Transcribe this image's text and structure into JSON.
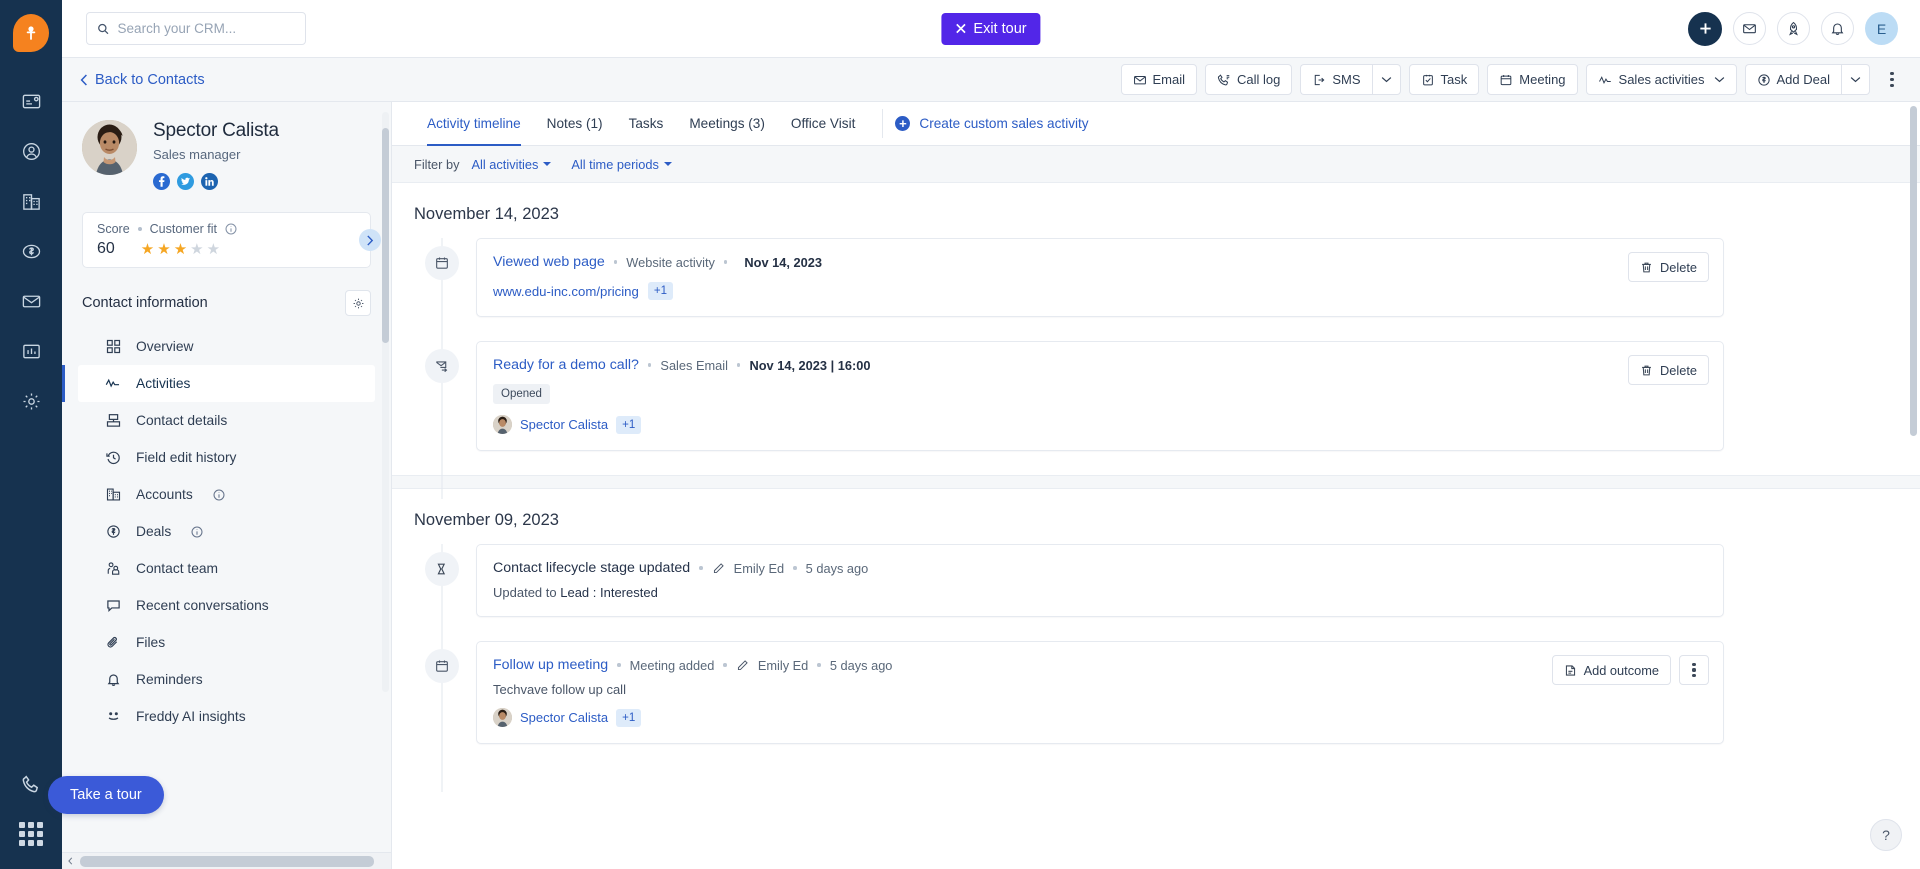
{
  "app": {
    "logo_icon": "freshworks-logo-icon",
    "rail_items": [
      {
        "name": "sidebar-rail-activities",
        "icon": "card-activity-icon"
      },
      {
        "name": "sidebar-rail-contacts",
        "icon": "contact-person-icon"
      },
      {
        "name": "sidebar-rail-accounts",
        "icon": "building-icon"
      },
      {
        "name": "sidebar-rail-deals",
        "icon": "dollar-circle-icon"
      },
      {
        "name": "sidebar-rail-email",
        "icon": "envelope-icon"
      },
      {
        "name": "sidebar-rail-reports",
        "icon": "bar-chart-icon"
      },
      {
        "name": "sidebar-rail-settings",
        "icon": "gear-icon"
      }
    ],
    "rail_bottom": [
      {
        "name": "sidebar-rail-phone",
        "icon": "phone-icon"
      },
      {
        "name": "sidebar-rail-apps",
        "icon": "apps-grid-icon"
      }
    ]
  },
  "topbar": {
    "search": {
      "placeholder": "Search your CRM...",
      "value": "",
      "icon": "search-icon"
    },
    "exit_tour_label": "Exit tour",
    "exit_tour_icon": "close-x-icon",
    "exit_tour_color": "#5226e8",
    "icons": [
      {
        "name": "add-new-button",
        "icon": "plus-icon"
      },
      {
        "name": "email-button",
        "icon": "envelope-icon"
      },
      {
        "name": "whats-new-button",
        "icon": "rocket-icon"
      },
      {
        "name": "notifications-button",
        "icon": "bell-icon"
      }
    ],
    "avatar_initial": "E"
  },
  "actionbar": {
    "back_label": "Back to Contacts",
    "back_icon": "chevron-left-icon",
    "buttons": [
      {
        "label": "Email",
        "icon": "envelope-icon",
        "name": "email-action-button"
      },
      {
        "label": "Call log",
        "icon": "phone-log-icon",
        "name": "call-log-action-button"
      },
      {
        "label": "SMS",
        "icon": "sms-icon",
        "name": "sms-action-button"
      },
      {
        "label": "Task",
        "icon": "task-check-icon",
        "name": "task-action-button"
      },
      {
        "label": "Meeting",
        "icon": "calendar-icon",
        "name": "meeting-action-button"
      },
      {
        "label": "Sales activities",
        "icon": "activity-pulse-icon",
        "name": "sales-activities-button"
      },
      {
        "label": "Add Deal",
        "icon": "dollar-circle-icon",
        "name": "add-deal-button"
      }
    ],
    "more_icon": "kebab-menu-icon"
  },
  "contact": {
    "name": "Spector Calista",
    "role": "Sales manager",
    "avatar_name": "contact-avatar",
    "socials": [
      {
        "name": "facebook-icon",
        "glyph": "f"
      },
      {
        "name": "twitter-icon",
        "glyph": "t"
      },
      {
        "name": "linkedin-icon",
        "glyph": "in"
      }
    ],
    "score_card": {
      "score_label": "Score",
      "fit_label": "Customer fit",
      "info_icon": "info-icon",
      "score_value": "60",
      "stars_filled": 3,
      "stars_total": 5,
      "expand_icon": "chevron-right-icon"
    },
    "info_title": "Contact information",
    "settings_icon": "gear-icon",
    "nav_items": [
      {
        "label": "Overview",
        "icon": "grid-squares-icon",
        "name": "sidebar-item-overview",
        "active": false,
        "info": false
      },
      {
        "label": "Activities",
        "icon": "activity-pulse-icon",
        "name": "sidebar-item-activities",
        "active": true,
        "info": false
      },
      {
        "label": "Contact details",
        "icon": "contact-details-icon",
        "name": "sidebar-item-contact-details",
        "active": false,
        "info": false
      },
      {
        "label": "Field edit history",
        "icon": "history-clock-icon",
        "name": "sidebar-item-field-edit-history",
        "active": false,
        "info": false
      },
      {
        "label": "Accounts",
        "icon": "building-icon",
        "name": "sidebar-item-accounts",
        "active": false,
        "info": true
      },
      {
        "label": "Deals",
        "icon": "dollar-circle-icon",
        "name": "sidebar-item-deals",
        "active": false,
        "info": true
      },
      {
        "label": "Contact team",
        "icon": "people-icon",
        "name": "sidebar-item-contact-team",
        "active": false,
        "info": false
      },
      {
        "label": "Recent conversations",
        "icon": "chat-bubble-icon",
        "name": "sidebar-item-recent-conversations",
        "active": false,
        "info": false
      },
      {
        "label": "Files",
        "icon": "paperclip-icon",
        "name": "sidebar-item-files",
        "active": false,
        "info": false
      },
      {
        "label": "Reminders",
        "icon": "bell-icon",
        "name": "sidebar-item-reminders",
        "active": false,
        "info": false
      },
      {
        "label": "Freddy AI insights",
        "icon": "freddy-ai-icon",
        "name": "sidebar-item-freddy-ai-insights",
        "active": false,
        "info": false
      }
    ]
  },
  "timeline": {
    "tabs": [
      {
        "label": "Activity timeline",
        "name": "tab-activity-timeline",
        "active": true
      },
      {
        "label": "Notes (1)",
        "name": "tab-notes",
        "active": false
      },
      {
        "label": "Tasks",
        "name": "tab-tasks",
        "active": false
      },
      {
        "label": "Meetings (3)",
        "name": "tab-meetings",
        "active": false
      },
      {
        "label": "Office Visit",
        "name": "tab-office-visit",
        "active": false
      }
    ],
    "create_label": "Create custom sales activity",
    "filter": {
      "label": "Filter by",
      "activities": "All activities",
      "periods": "All time periods"
    },
    "groups": [
      {
        "date": "November 14, 2023",
        "items": [
          {
            "icon": "calendar-icon",
            "title": "Viewed web page",
            "title_style": "link",
            "type": "Website activity",
            "date": "Nov 14, 2023",
            "link": "www.edu-inc.com/pricing",
            "plus_badge": "+1",
            "action": {
              "label": "Delete",
              "icon": "trash-icon",
              "name": "delete-activity-button"
            }
          },
          {
            "icon": "email-sent-icon",
            "title": "Ready for a demo call?",
            "title_style": "link",
            "type": "Sales Email",
            "date": "Nov 14, 2023 | 16:00",
            "tag": "Opened",
            "person": "Spector Calista",
            "plus_badge": "+1",
            "action": {
              "label": "Delete",
              "icon": "trash-icon",
              "name": "delete-activity-button"
            }
          }
        ]
      },
      {
        "date": "November 09, 2023",
        "items": [
          {
            "icon": "lifecycle-stage-icon",
            "title": "Contact lifecycle stage updated",
            "title_style": "plain",
            "author": "Emily Ed",
            "author_icon": "pencil-icon",
            "time": "5 days ago",
            "sub_prefix": "Updated to",
            "sub_value": "Lead : Interested"
          },
          {
            "icon": "calendar-icon",
            "title": "Follow up meeting",
            "title_style": "link",
            "type": "Meeting added",
            "author": "Emily Ed",
            "author_icon": "pencil-icon",
            "time": "5 days ago",
            "sub_value": "Techvave follow up call",
            "person": "Spector Calista",
            "plus_badge": "+1",
            "action": {
              "label": "Add outcome",
              "icon": "outcome-icon",
              "name": "add-outcome-button"
            },
            "more_icon": "kebab-menu-icon"
          }
        ]
      }
    ]
  },
  "floating": {
    "take_tour_label": "Take a tour",
    "help_label": "?",
    "help_name": "help-button"
  }
}
